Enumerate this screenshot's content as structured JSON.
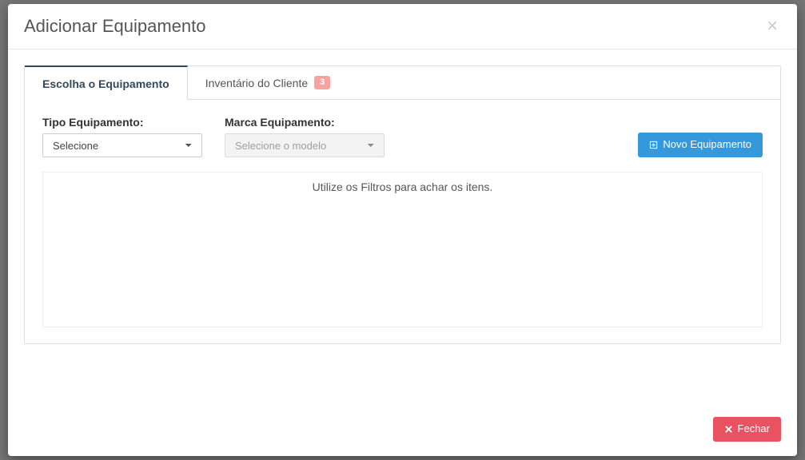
{
  "modal": {
    "title": "Adicionar Equipamento",
    "tabs": [
      {
        "label": "Escolha o Equipamento"
      },
      {
        "label": "Inventário do Cliente",
        "badge": "3"
      }
    ],
    "filters": {
      "type_label": "Tipo Equipamento:",
      "type_placeholder": "Selecione",
      "brand_label": "Marca Equipamento:",
      "brand_placeholder": "Selecione o modelo"
    },
    "new_equipment_label": "Novo Equipamento",
    "results_empty": "Utilize os Filtros para achar os itens.",
    "close_label": "Fechar"
  }
}
